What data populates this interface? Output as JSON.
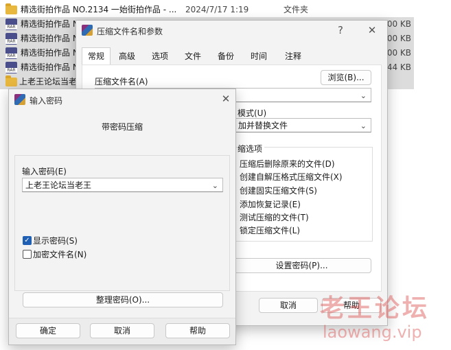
{
  "file_list": [
    {
      "name": "精选街拍作品 NO.2134 一始街拍作品 - ...",
      "date": "2024/7/17 1:19",
      "type": "文件夹",
      "size": "",
      "icon": "folder",
      "selected": false
    },
    {
      "name": "精选街拍作品 N",
      "date": "",
      "type": "",
      "size": "00 KB",
      "icon": "rar",
      "selected": true
    },
    {
      "name": "精选街拍作品 N",
      "date": "",
      "type": "",
      "size": "00 KB",
      "icon": "rar",
      "selected": true
    },
    {
      "name": "精选街拍作品 N",
      "date": "",
      "type": "",
      "size": "00 KB",
      "icon": "rar",
      "selected": true
    },
    {
      "name": "精选街拍作品 N",
      "date": "",
      "type": "",
      "size": "44 KB",
      "icon": "rar",
      "selected": true
    },
    {
      "name": "上老王论坛当老",
      "date": "",
      "type": "",
      "size": "",
      "icon": "folder",
      "selected": true
    }
  ],
  "rar_icon_label": "RAR",
  "archive_dialog": {
    "title": "压缩文件名和参数",
    "help_glyph": "?",
    "close_glyph": "✕",
    "tabs": [
      "常规",
      "高级",
      "选项",
      "文件",
      "备份",
      "时间",
      "注释"
    ],
    "archive_name_label": "压缩文件名(A)",
    "browse_button": "浏览(B)...",
    "update_mode_label": "模式(U)",
    "update_mode_value": "加并替换文件",
    "options_label": "缩选项",
    "options": [
      "压缩后删除原来的文件(D)",
      "创建自解压格式压缩文件(X)",
      "创建固实压缩文件(S)",
      "添加恢复记录(E)",
      "测试压缩的文件(T)",
      "锁定压缩文件(L)"
    ],
    "set_password_button": "设置密码(P)...",
    "cancel_button": "取消",
    "help_button": "帮助"
  },
  "password_dialog": {
    "title": "输入密码",
    "close_glyph": "✕",
    "heading": "带密码压缩",
    "password_label": "输入密码(E)",
    "password_value": "上老王论坛当老王",
    "show_password_label": "显示密码(S)",
    "show_password_checked": true,
    "encrypt_names_label": "加密文件名(N)",
    "encrypt_names_checked": false,
    "organize_button": "整理密码(O)...",
    "ok_button": "确定",
    "cancel_button": "取消",
    "help_button": "帮助"
  },
  "watermark": {
    "line1": "老王论坛",
    "line2": "laowang.vip"
  },
  "colors": {
    "accent": "#1f5fb4",
    "selection": "#dcdcdc",
    "watermark": "#dc5050"
  }
}
